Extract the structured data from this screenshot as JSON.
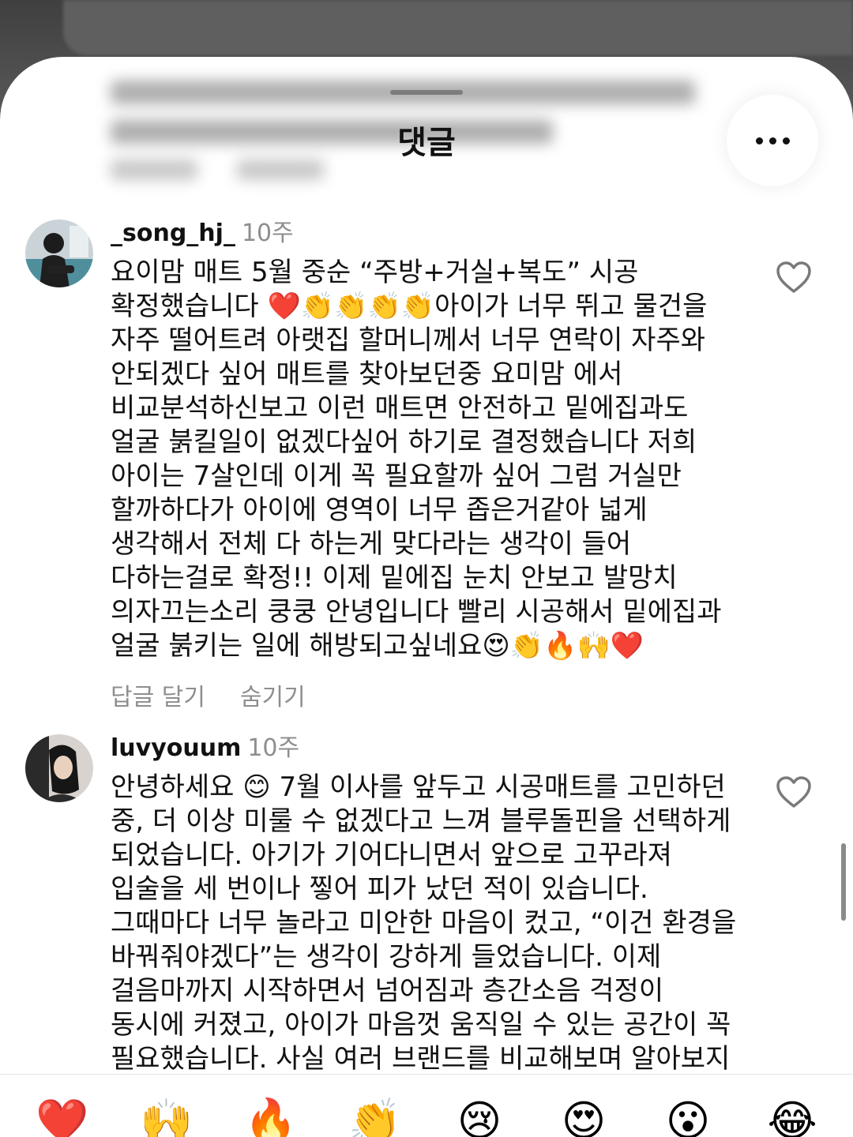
{
  "sheet": {
    "title": "댓글",
    "more_icon": "more-horizontal-icon"
  },
  "comments": [
    {
      "username": "_song_hj_",
      "time": "10주",
      "text": "요이맘 매트 5월 중순 “주방+거실+복도” 시공 확정했습니다 ❤️👏👏👏👏아이가 너무 뛰고 물건을 자주 떨어트려 아랫집 할머니께서 너무 연락이 자주와 안되겠다 싶어 매트를 찾아보던중 요미맘 에서 비교분석하신보고 이런 매트면 안전하고 밑에집과도 얼굴 붉킬일이 없겠다싶어 하기로 결정했습니다 저희 아이는 7살인데 이게 꼭 필요할까 싶어 그럼 거실만 할까하다가 아이에 영역이 너무 좁은거같아 넓게 생각해서 전체 다 하는게 맞다라는 생각이 들어 다하는걸로 확정!! 이제 밑에집 눈치 안보고 발망치 의자끄는소리 쿵쿵 안녕입니다 빨리 시공해서 밑에집과 얼굴 붉키는 일에 해방되고싶네요😍👏🔥🙌❤️",
      "reply_label": "답글 달기",
      "hide_label": "숨기기",
      "like_icon": "heart-outline-icon"
    },
    {
      "username": "luvyouum",
      "time": "10주",
      "text": "안녕하세요 😊 7월 이사를 앞두고 시공매트를 고민하던 중, 더 이상 미룰 수 없겠다고 느껴 블루돌핀을 선택하게 되었습니다. 아기가 기어다니면서 앞으로 고꾸라져 입술을 세 번이나 찧어 피가 났던 적이 있습니다. 그때마다 너무 놀라고 미안한 마음이 컸고, “이건 환경을 바꿔줘야겠다”는 생각이 강하게 들었습니다. 이제 걸음마까지 시작하면서 넘어짐과 층간소음 걱정이 동시에 커졌고, 아이가 마음껏 움직일 수 있는 공간이 꼭 필요했습니다. 사실 여러 브랜드를 비교해보며 알아보지",
      "like_icon": "heart-outline-icon"
    }
  ],
  "emoji_bar": [
    "❤️",
    "🙌",
    "🔥",
    "👏",
    "😢",
    "😍",
    "😮",
    "😂"
  ]
}
